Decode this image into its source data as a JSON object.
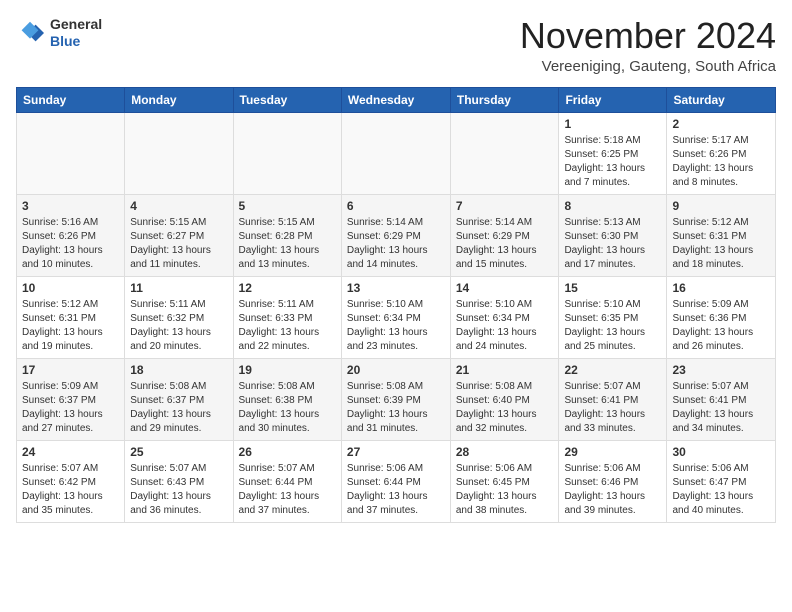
{
  "header": {
    "logo_general": "General",
    "logo_blue": "Blue",
    "month_title": "November 2024",
    "subtitle": "Vereeniging, Gauteng, South Africa"
  },
  "weekdays": [
    "Sunday",
    "Monday",
    "Tuesday",
    "Wednesday",
    "Thursday",
    "Friday",
    "Saturday"
  ],
  "weeks": [
    [
      {
        "day": "",
        "content": ""
      },
      {
        "day": "",
        "content": ""
      },
      {
        "day": "",
        "content": ""
      },
      {
        "day": "",
        "content": ""
      },
      {
        "day": "",
        "content": ""
      },
      {
        "day": "1",
        "content": "Sunrise: 5:18 AM\nSunset: 6:25 PM\nDaylight: 13 hours\nand 7 minutes."
      },
      {
        "day": "2",
        "content": "Sunrise: 5:17 AM\nSunset: 6:26 PM\nDaylight: 13 hours\nand 8 minutes."
      }
    ],
    [
      {
        "day": "3",
        "content": "Sunrise: 5:16 AM\nSunset: 6:26 PM\nDaylight: 13 hours\nand 10 minutes."
      },
      {
        "day": "4",
        "content": "Sunrise: 5:15 AM\nSunset: 6:27 PM\nDaylight: 13 hours\nand 11 minutes."
      },
      {
        "day": "5",
        "content": "Sunrise: 5:15 AM\nSunset: 6:28 PM\nDaylight: 13 hours\nand 13 minutes."
      },
      {
        "day": "6",
        "content": "Sunrise: 5:14 AM\nSunset: 6:29 PM\nDaylight: 13 hours\nand 14 minutes."
      },
      {
        "day": "7",
        "content": "Sunrise: 5:14 AM\nSunset: 6:29 PM\nDaylight: 13 hours\nand 15 minutes."
      },
      {
        "day": "8",
        "content": "Sunrise: 5:13 AM\nSunset: 6:30 PM\nDaylight: 13 hours\nand 17 minutes."
      },
      {
        "day": "9",
        "content": "Sunrise: 5:12 AM\nSunset: 6:31 PM\nDaylight: 13 hours\nand 18 minutes."
      }
    ],
    [
      {
        "day": "10",
        "content": "Sunrise: 5:12 AM\nSunset: 6:31 PM\nDaylight: 13 hours\nand 19 minutes."
      },
      {
        "day": "11",
        "content": "Sunrise: 5:11 AM\nSunset: 6:32 PM\nDaylight: 13 hours\nand 20 minutes."
      },
      {
        "day": "12",
        "content": "Sunrise: 5:11 AM\nSunset: 6:33 PM\nDaylight: 13 hours\nand 22 minutes."
      },
      {
        "day": "13",
        "content": "Sunrise: 5:10 AM\nSunset: 6:34 PM\nDaylight: 13 hours\nand 23 minutes."
      },
      {
        "day": "14",
        "content": "Sunrise: 5:10 AM\nSunset: 6:34 PM\nDaylight: 13 hours\nand 24 minutes."
      },
      {
        "day": "15",
        "content": "Sunrise: 5:10 AM\nSunset: 6:35 PM\nDaylight: 13 hours\nand 25 minutes."
      },
      {
        "day": "16",
        "content": "Sunrise: 5:09 AM\nSunset: 6:36 PM\nDaylight: 13 hours\nand 26 minutes."
      }
    ],
    [
      {
        "day": "17",
        "content": "Sunrise: 5:09 AM\nSunset: 6:37 PM\nDaylight: 13 hours\nand 27 minutes."
      },
      {
        "day": "18",
        "content": "Sunrise: 5:08 AM\nSunset: 6:37 PM\nDaylight: 13 hours\nand 29 minutes."
      },
      {
        "day": "19",
        "content": "Sunrise: 5:08 AM\nSunset: 6:38 PM\nDaylight: 13 hours\nand 30 minutes."
      },
      {
        "day": "20",
        "content": "Sunrise: 5:08 AM\nSunset: 6:39 PM\nDaylight: 13 hours\nand 31 minutes."
      },
      {
        "day": "21",
        "content": "Sunrise: 5:08 AM\nSunset: 6:40 PM\nDaylight: 13 hours\nand 32 minutes."
      },
      {
        "day": "22",
        "content": "Sunrise: 5:07 AM\nSunset: 6:41 PM\nDaylight: 13 hours\nand 33 minutes."
      },
      {
        "day": "23",
        "content": "Sunrise: 5:07 AM\nSunset: 6:41 PM\nDaylight: 13 hours\nand 34 minutes."
      }
    ],
    [
      {
        "day": "24",
        "content": "Sunrise: 5:07 AM\nSunset: 6:42 PM\nDaylight: 13 hours\nand 35 minutes."
      },
      {
        "day": "25",
        "content": "Sunrise: 5:07 AM\nSunset: 6:43 PM\nDaylight: 13 hours\nand 36 minutes."
      },
      {
        "day": "26",
        "content": "Sunrise: 5:07 AM\nSunset: 6:44 PM\nDaylight: 13 hours\nand 37 minutes."
      },
      {
        "day": "27",
        "content": "Sunrise: 5:06 AM\nSunset: 6:44 PM\nDaylight: 13 hours\nand 37 minutes."
      },
      {
        "day": "28",
        "content": "Sunrise: 5:06 AM\nSunset: 6:45 PM\nDaylight: 13 hours\nand 38 minutes."
      },
      {
        "day": "29",
        "content": "Sunrise: 5:06 AM\nSunset: 6:46 PM\nDaylight: 13 hours\nand 39 minutes."
      },
      {
        "day": "30",
        "content": "Sunrise: 5:06 AM\nSunset: 6:47 PM\nDaylight: 13 hours\nand 40 minutes."
      }
    ]
  ]
}
